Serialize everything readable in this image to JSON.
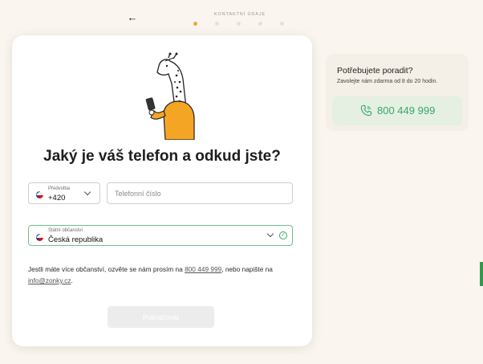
{
  "header": {
    "back_icon": "arrow-left-icon",
    "step_label": "KONTAKTNÍ ÚDAJE",
    "steps_total": 5,
    "step_current": 1
  },
  "card": {
    "heading": "Jaký je váš telefon a odkud jste?",
    "prefix": {
      "label": "Předvolba",
      "value": "+420",
      "flag": "cz-flag-icon"
    },
    "phone": {
      "placeholder": "Telefonní číslo",
      "value": ""
    },
    "citizenship": {
      "label": "Státní občanství",
      "value": "Česká republika",
      "flag": "cz-flag-icon",
      "valid": true
    },
    "note": {
      "text_before": "Jestli máte více občanství, ozvěte se nám prosím na ",
      "phone_link": "800 449 999",
      "text_middle": ", nebo napište na ",
      "email_link": "info@zonky.cz",
      "text_after": "."
    },
    "continue_label": "Pokračovat"
  },
  "help": {
    "title": "Potřebujete poradit?",
    "subtitle": "Zavolejte nám zdarma od 8 do 20 hodin.",
    "phone": "800 449 999",
    "phone_icon": "phone-icon"
  },
  "colors": {
    "background": "#faf6ef",
    "accent_orange": "#f2a93b",
    "accent_green": "#38a86a",
    "valid_border": "#6fc18b"
  }
}
